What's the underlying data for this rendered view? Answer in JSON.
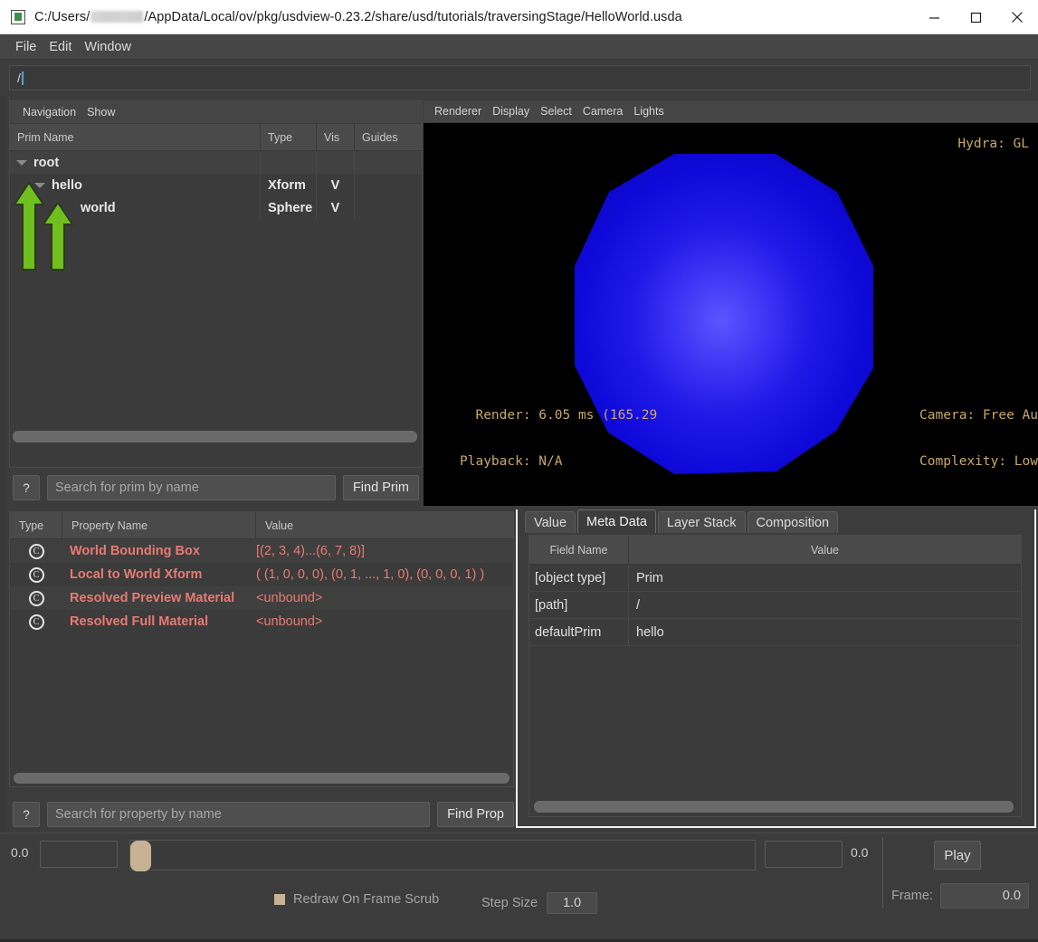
{
  "window": {
    "title_prefix": "C:/Users/",
    "title_suffix": "/AppData/Local/ov/pkg/usdview-0.23.2/share/usd/tutorials/traversingStage/HelloWorld.usda",
    "app_icon": "usdview-icon",
    "minimize": "minimize-icon",
    "maximize": "maximize-icon",
    "close": "close-icon"
  },
  "menubar": {
    "items": [
      "File",
      "Edit",
      "Window"
    ]
  },
  "pathbar": {
    "value": "/"
  },
  "tree": {
    "menu": [
      "Navigation",
      "Show"
    ],
    "columns": [
      "Prim Name",
      "Type",
      "Vis",
      "Guides"
    ],
    "rows": [
      {
        "name": "root",
        "type": "",
        "vis": "",
        "guides": "",
        "depth": 0,
        "expanded": true
      },
      {
        "name": "hello",
        "type": "Xform",
        "vis": "V",
        "guides": "",
        "depth": 1,
        "expanded": true
      },
      {
        "name": "world",
        "type": "Sphere",
        "vis": "V",
        "guides": "",
        "depth": 2,
        "expanded": false
      }
    ]
  },
  "prim_search": {
    "help": "?",
    "placeholder": "Search for prim by name",
    "value": "",
    "find_label": "Find Prim"
  },
  "viewport": {
    "menu": [
      "Renderer",
      "Display",
      "Select",
      "Camera",
      "Lights"
    ],
    "hydra": "Hydra: GL",
    "render_line": "  Render: 6.05 ms (165.29",
    "playback_line": "Playback: N/A",
    "camera_line": "Camera: Free Au",
    "complexity_line": "Complexity: Low",
    "hud_color": "#c8a96a",
    "sphere_color_center": "#4a46f0",
    "sphere_color_edge": "#0b0bd2",
    "background": "#000000"
  },
  "properties": {
    "columns": [
      "Type",
      "Property Name",
      "Value"
    ],
    "rows": [
      {
        "icon": "C",
        "name": "World Bounding Box",
        "value": "[(2, 3, 4)...(6, 7, 8)]"
      },
      {
        "icon": "C",
        "name": "Local to World Xform",
        "value": "( (1, 0, 0, 0), (0, 1, ..., 1, 0), (0, 0, 0, 1) )"
      },
      {
        "icon": "C",
        "name": "Resolved Preview Material",
        "value": "<unbound>"
      },
      {
        "icon": "C",
        "name": "Resolved Full Material",
        "value": "<unbound>"
      }
    ],
    "text_color": "#e87a72"
  },
  "prop_search": {
    "help": "?",
    "placeholder": "Search for property by name",
    "value": "",
    "find_label": "Find Prop"
  },
  "metadata": {
    "tabs": [
      {
        "label": "Value",
        "active": false
      },
      {
        "label": "Meta Data",
        "active": true
      },
      {
        "label": "Layer Stack",
        "active": false
      },
      {
        "label": "Composition",
        "active": false
      }
    ],
    "columns": [
      "Field Name",
      "Value"
    ],
    "rows": [
      {
        "field": "[object type]",
        "value": "Prim"
      },
      {
        "field": "[path]",
        "value": "/"
      },
      {
        "field": "defaultPrim",
        "value": "hello"
      }
    ]
  },
  "timeline": {
    "start_value": "0.0",
    "start_field": "",
    "end_field": "",
    "end_value": "0.0",
    "redraw_label": "Redraw On Frame Scrub",
    "redraw_checked": true,
    "step_size_label": "Step Size",
    "step_size_value": "1.0",
    "play_label": "Play",
    "frame_label": "Frame:",
    "frame_value": "0.0",
    "handle_color": "#c7b393"
  },
  "annotations": {
    "arrow_color": "#6fbf1f",
    "arrows": [
      "expand-root-arrow",
      "expand-hello-arrow"
    ]
  }
}
